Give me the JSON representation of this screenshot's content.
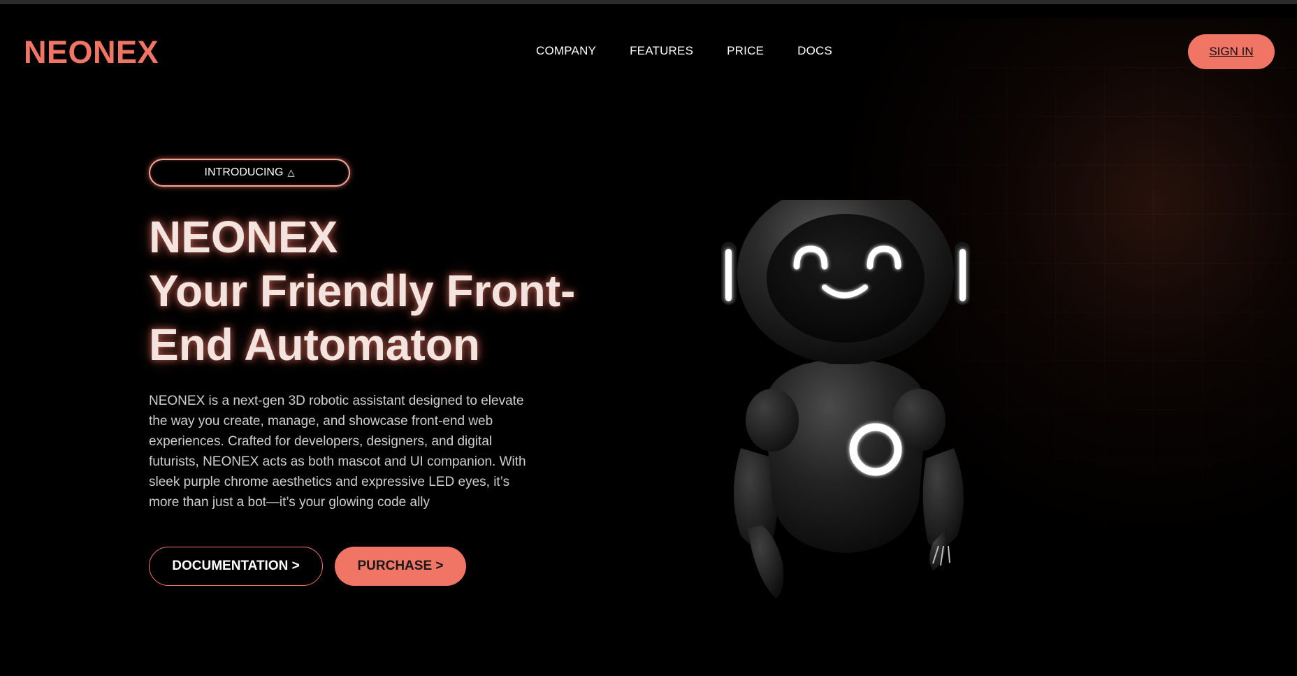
{
  "header": {
    "logo": "NEONEX",
    "nav": [
      "COMPANY",
      "FEATURES",
      "PRICE",
      "DOCS"
    ],
    "signin_label": "SIGN IN"
  },
  "hero": {
    "badge_label": "INTRODUCING",
    "badge_icon": "delta-icon",
    "title_line1": "NEONEX",
    "title_line2": "Your Friendly Front-End Automaton",
    "description": "NEONEX is a next-gen 3D robotic assistant designed to elevate the way you create, manage, and showcase front-end web experiences. Crafted for developers, designers, and digital futurists, NEONEX acts as both mascot and UI companion. With sleek purple chrome aesthetics and expressive LED eyes, it’s more than just a bot—it’s your glowing code ally",
    "doc_button": "DOCUMENTATION >",
    "purchase_button": "PURCHASE >"
  },
  "colors": {
    "accent": "#f07565",
    "background": "#000000",
    "text": "#ffffff"
  }
}
